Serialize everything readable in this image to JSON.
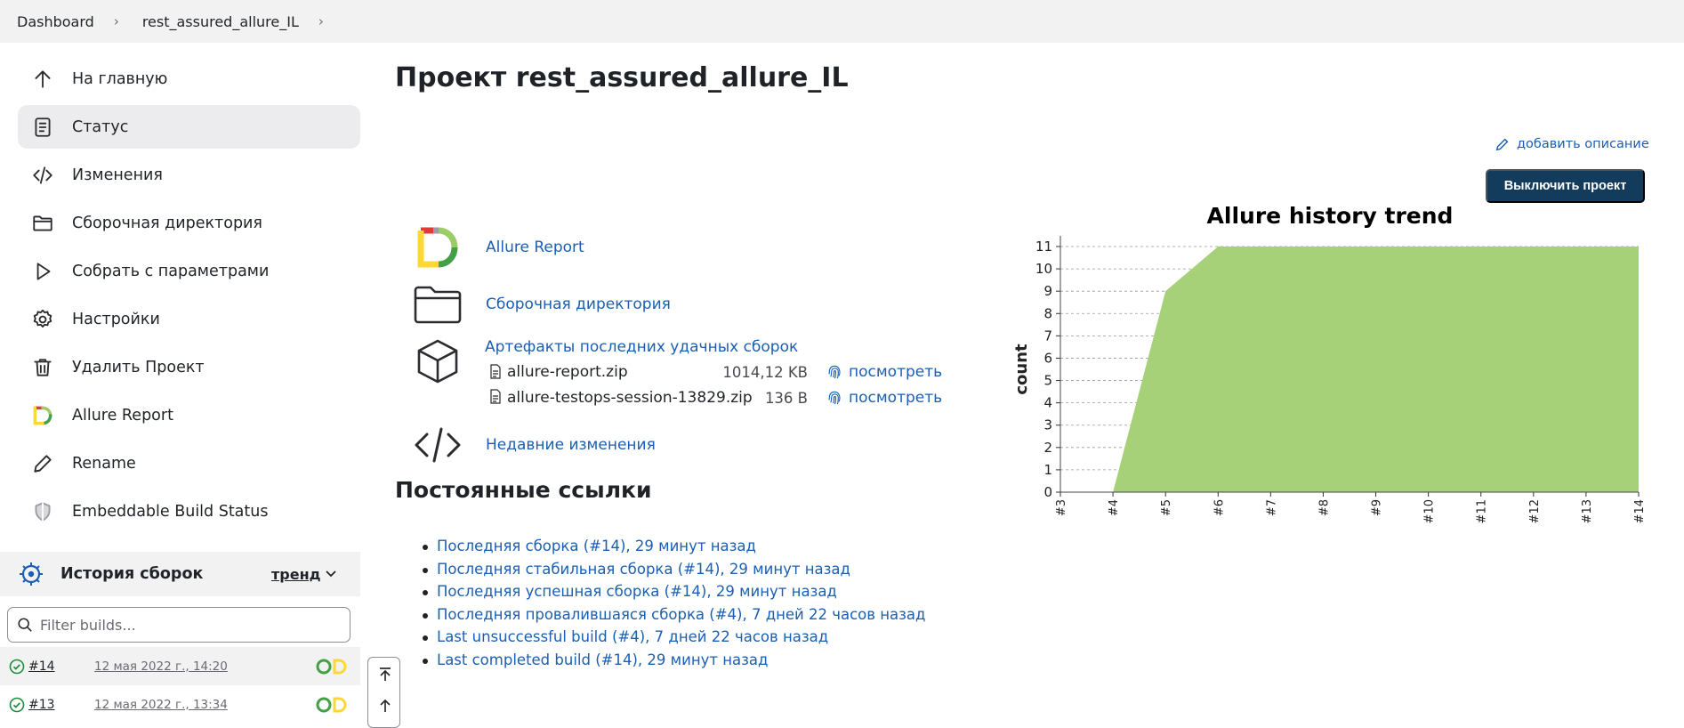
{
  "breadcrumb": {
    "items": [
      "Dashboard",
      "rest_assured_allure_IL"
    ]
  },
  "sidebar": {
    "items": [
      {
        "label": "На главную",
        "icon": "arrow-up-icon"
      },
      {
        "label": "Статус",
        "icon": "document-icon"
      },
      {
        "label": "Изменения",
        "icon": "code-icon"
      },
      {
        "label": "Сборочная директория",
        "icon": "folder-icon"
      },
      {
        "label": "Собрать с параметрами",
        "icon": "play-icon"
      },
      {
        "label": "Настройки",
        "icon": "gear-icon"
      },
      {
        "label": "Удалить Проект",
        "icon": "trash-icon"
      },
      {
        "label": "Allure Report",
        "icon": "allure-icon"
      },
      {
        "label": "Rename",
        "icon": "pencil-icon"
      },
      {
        "label": "Embeddable Build Status",
        "icon": "shield-icon"
      }
    ],
    "active_index": 1
  },
  "build_history": {
    "title": "История сборок",
    "trend_label": "тренд",
    "filter_placeholder": "Filter builds...",
    "builds": [
      {
        "number": "#14",
        "date": "12 мая 2022 г., 14:20"
      },
      {
        "number": "#13",
        "date": "12 мая 2022 г., 13:34"
      }
    ]
  },
  "main": {
    "title": "Проект rest_assured_allure_IL",
    "add_description": "добавить описание",
    "disable_button": "Выключить проект",
    "links": {
      "allure_report": "Allure Report",
      "workspace": "Сборочная директория",
      "artifacts": "Артефакты последних удачных сборок",
      "recent_changes": "Недавние изменения"
    },
    "artifacts": [
      {
        "file": "allure-report.zip",
        "size": "1014,12 KB",
        "view": "посмотреть"
      },
      {
        "file": "allure-testops-session-13829.zip",
        "size": "136 B",
        "view": "посмотреть"
      }
    ],
    "permalinks_title": "Постоянные ссылки",
    "permalinks": [
      "Последняя сборка (#14), 29 минут назад",
      "Последняя стабильная сборка (#14), 29 минут назад",
      "Последняя успешная сборка (#14), 29 минут назад",
      "Последняя провалившаяся сборка (#4), 7 дней 22 часов назад",
      "Last unsuccessful build (#4), 7 дней 22 часов назад",
      "Last completed build (#14), 29 минут назад"
    ]
  },
  "chart_data": {
    "type": "area",
    "title": "Allure history trend",
    "xlabel": "",
    "ylabel": "count",
    "categories": [
      "#3",
      "#4",
      "#5",
      "#6",
      "#7",
      "#8",
      "#9",
      "#10",
      "#11",
      "#12",
      "#13",
      "#14"
    ],
    "series": [
      {
        "values": [
          null,
          0,
          9,
          11,
          11,
          11,
          11,
          11,
          11,
          11,
          11,
          11
        ],
        "color": "#a6d179"
      }
    ],
    "ylim": [
      0,
      11
    ],
    "yticks": [
      0,
      1,
      2,
      3,
      4,
      5,
      6,
      7,
      8,
      9,
      10,
      11
    ],
    "grid": true
  }
}
